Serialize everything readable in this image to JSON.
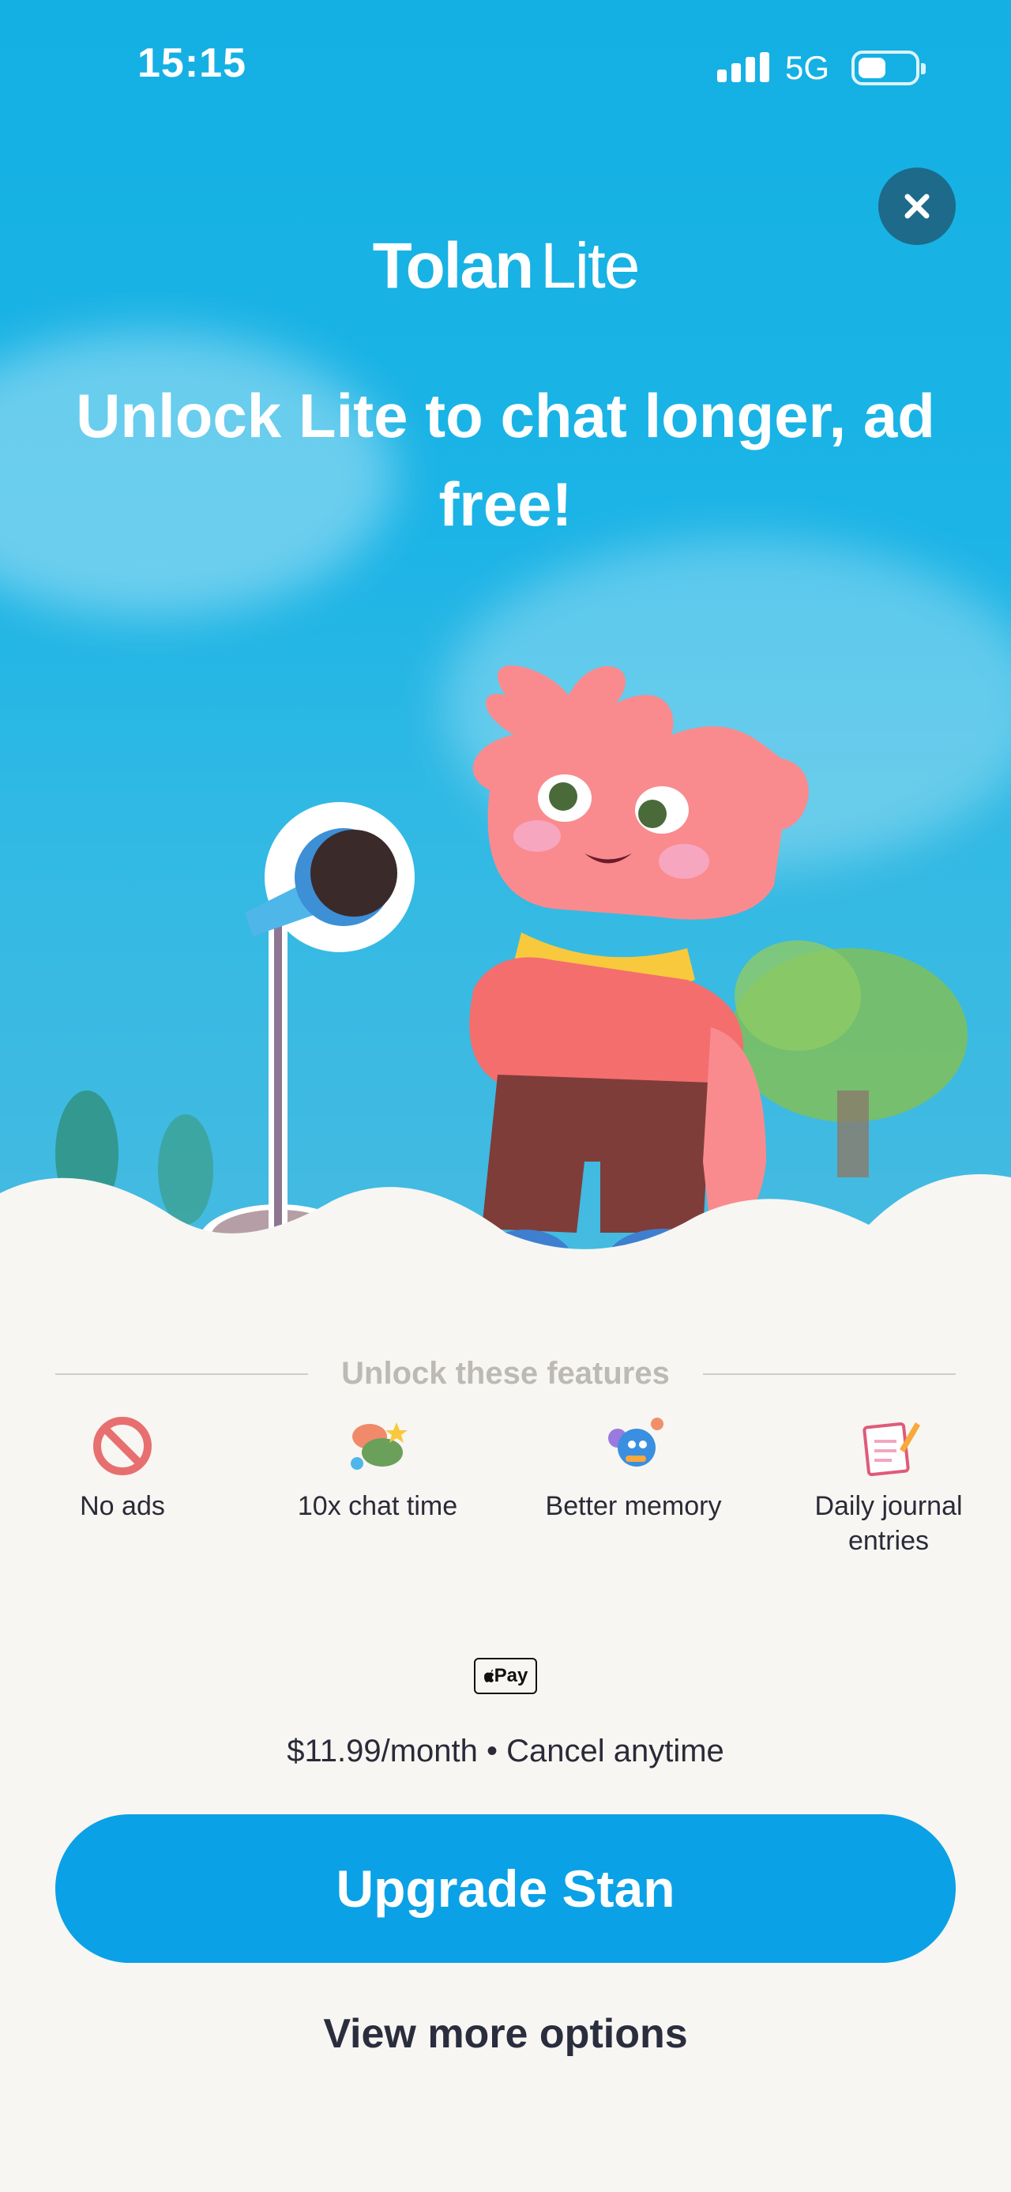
{
  "status_bar": {
    "time": "15:15",
    "network": "5G"
  },
  "brand": {
    "name_bold": "Tolan",
    "name_light": "Lite"
  },
  "headline": "Unlock Lite to chat longer, ad free!",
  "features": {
    "section_title": "Unlock these features",
    "items": [
      {
        "label": "No ads",
        "icon": "no-ads-icon"
      },
      {
        "label": "10x chat time",
        "icon": "chat-bubbles-icon"
      },
      {
        "label": "Better memory",
        "icon": "memory-icon"
      },
      {
        "label": "Daily journal entries",
        "icon": "journal-icon"
      }
    ]
  },
  "payment": {
    "method": "Pay",
    "price_text": "$11.99/month • Cancel anytime"
  },
  "actions": {
    "upgrade_label": "Upgrade Stan",
    "more_options_label": "View more options"
  },
  "colors": {
    "sky": "#14b0e3",
    "button": "#0aa1e7",
    "background": "#f7f6f2"
  }
}
